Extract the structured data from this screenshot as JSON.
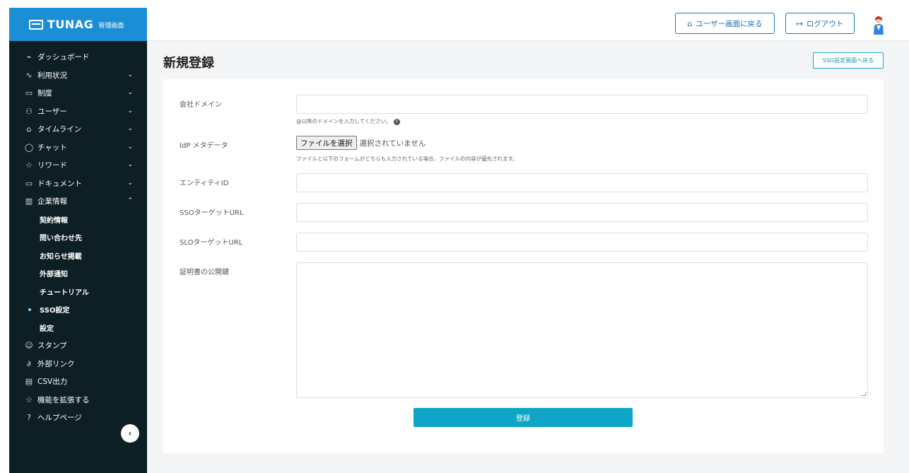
{
  "brand": {
    "name": "TUNAG",
    "subtitle": "管理画面"
  },
  "header": {
    "back_to_user_label": "ユーザー画面に戻る",
    "logout_label": "ログアウト"
  },
  "sidebar": {
    "items": [
      {
        "icon": "dashboard-icon",
        "label": "ダッシュボード",
        "chevron": ""
      },
      {
        "icon": "activity-icon",
        "label": "利用状況",
        "chevron": "down"
      },
      {
        "icon": "book-icon",
        "label": "制度",
        "chevron": "down"
      },
      {
        "icon": "users-icon",
        "label": "ユーザー",
        "chevron": "down"
      },
      {
        "icon": "home-icon",
        "label": "タイムライン",
        "chevron": "down"
      },
      {
        "icon": "chat-icon",
        "label": "チャット",
        "chevron": "down"
      },
      {
        "icon": "star-icon",
        "label": "リワード",
        "chevron": "down"
      },
      {
        "icon": "folder-icon",
        "label": "ドキュメント",
        "chevron": "down"
      },
      {
        "icon": "building-icon",
        "label": "企業情報",
        "chevron": "up"
      }
    ],
    "sub_items": [
      "契約情報",
      "問い合わせ先",
      "お知らせ掲載",
      "外部通知",
      "チュートリアル",
      "SSO設定",
      "設定"
    ],
    "active_sub_item": "SSO設定",
    "bottom_items": [
      {
        "icon": "smile-icon",
        "label": "スタンプ"
      },
      {
        "icon": "link-icon",
        "label": "外部リンク"
      },
      {
        "icon": "table-icon",
        "label": "CSV出力"
      },
      {
        "icon": "extension-icon",
        "label": "機能を拡張する"
      },
      {
        "icon": "help-icon",
        "label": "ヘルプページ"
      }
    ]
  },
  "main": {
    "title": "新規登録",
    "sso_back_label": "SSO設定画面へ戻る",
    "form": {
      "company_domain_label": "会社ドメイン",
      "company_domain_value": "",
      "company_domain_help": "@以降のドメインを入力してください。",
      "idp_metadata_label": "IdP メタデータ",
      "file_button_label": "ファイルを選択",
      "file_status": "選択されていません",
      "file_help": "ファイルと以下のフォームがどちらも入力されている場合、ファイルの内容が優先されます。",
      "entity_id_label": "エンティティID",
      "entity_id_value": "",
      "sso_url_label": "SSOターゲットURL",
      "sso_url_value": "",
      "slo_url_label": "SLOターゲットURL",
      "slo_url_value": "",
      "cert_label": "証明書の公開鍵",
      "cert_value": "",
      "submit_label": "登録"
    }
  },
  "colors": {
    "sidebar_bg": "#0d1f24",
    "brand_bg": "#1a8fd6",
    "accent": "#0ea6c6",
    "content_bg": "#f3f5f7"
  }
}
